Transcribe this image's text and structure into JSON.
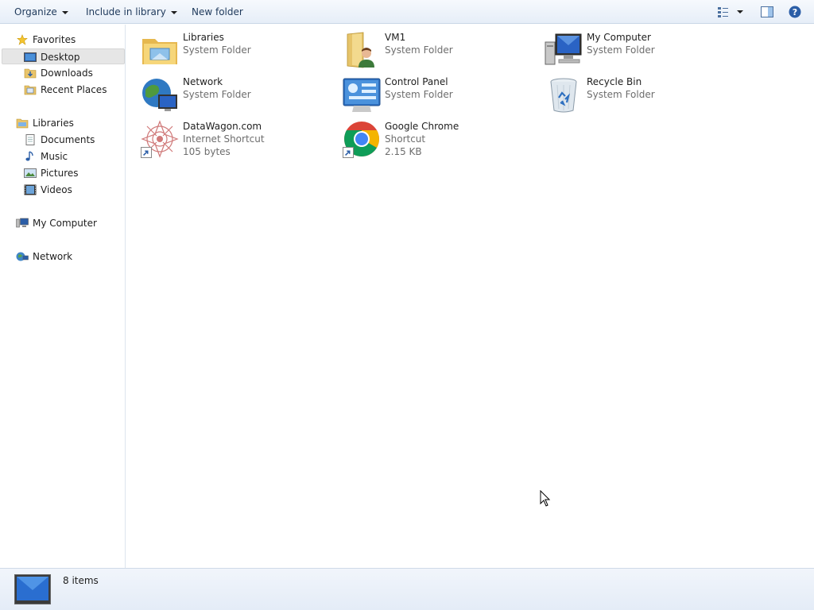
{
  "toolbar": {
    "organize_label": "Organize",
    "include_label": "Include in library",
    "new_folder_label": "New folder"
  },
  "nav": {
    "favorites": "Favorites",
    "desktop": "Desktop",
    "downloads": "Downloads",
    "recent_places": "Recent Places",
    "libraries": "Libraries",
    "documents": "Documents",
    "music": "Music",
    "pictures": "Pictures",
    "videos": "Videos",
    "my_computer": "My Computer",
    "network": "Network"
  },
  "items": [
    {
      "name": "Libraries",
      "type": "System Folder",
      "icon": "libraries-icon"
    },
    {
      "name": "VM1",
      "type": "System Folder",
      "icon": "user-folder-icon"
    },
    {
      "name": "My Computer",
      "type": "System Folder",
      "icon": "computer-icon"
    },
    {
      "name": "Network",
      "type": "System Folder",
      "icon": "network-icon"
    },
    {
      "name": "Control Panel",
      "type": "System Folder",
      "icon": "control-panel-icon"
    },
    {
      "name": "Recycle Bin",
      "type": "System Folder",
      "icon": "recycle-bin-icon"
    },
    {
      "name": "DataWagon.com",
      "type": "Internet Shortcut",
      "size": "105 bytes",
      "icon": "internet-shortcut-icon"
    },
    {
      "name": "Google Chrome",
      "type": "Shortcut",
      "size": "2.15 KB",
      "icon": "chrome-icon"
    }
  ],
  "status": {
    "count": "8 items"
  }
}
